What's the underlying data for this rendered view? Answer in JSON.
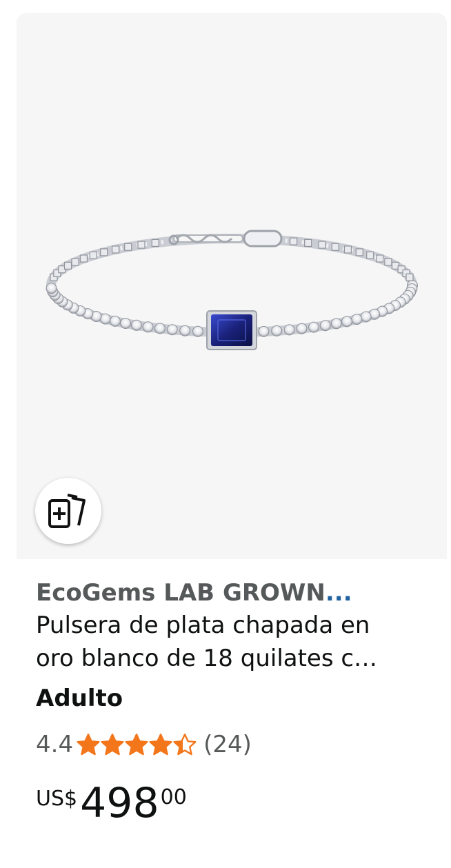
{
  "product": {
    "brand": "EcoGems LAB GROWN",
    "brand_ellipsis": "...",
    "title_line1": "Pulsera de plata chapada en",
    "title_line2": "oro blanco de 18 quilates c…",
    "variant": "Adulto",
    "rating": "4.4",
    "rating_value": 4.4,
    "review_count": "(24)",
    "price_symbol": "US$",
    "price_whole": "498",
    "price_fraction": "00",
    "image_icon": "tennis-bracelet-blue-sapphire"
  },
  "actions": {
    "compare_icon": "add-to-compare-icon"
  },
  "colors": {
    "star": "#f3761b",
    "brand_text": "#565959",
    "ellipsis": "#2162a1",
    "image_bg": "#f6f6f6",
    "gem": "#1f2a8a"
  }
}
